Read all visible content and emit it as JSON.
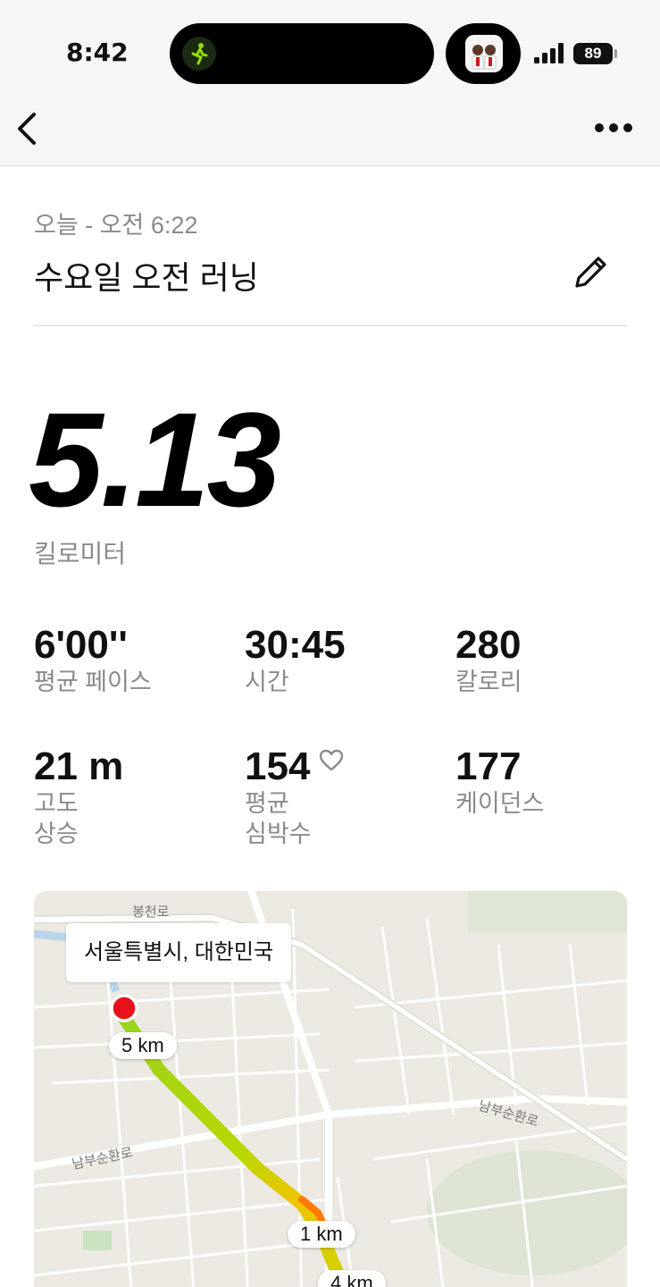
{
  "status_bar": {
    "time": "8:42",
    "battery": "89"
  },
  "activity": {
    "date": "오늘 - 오전 6:22",
    "title": "수요일 오전 러닝",
    "distance": "5.13",
    "distance_unit": "킬로미터"
  },
  "stats": [
    {
      "value": "6'00''",
      "label": "평균 페이스"
    },
    {
      "value": "30:45",
      "label": "시간"
    },
    {
      "value": "280",
      "label": "칼로리"
    },
    {
      "value": "21 m",
      "label": "고도\n상승"
    },
    {
      "value": "154",
      "label": "평균\n심박수"
    },
    {
      "value": "177",
      "label": "케이던스"
    }
  ],
  "map": {
    "location": "서울특별시, 대한민국",
    "roads": [
      "봉천로",
      "남부순환로",
      "남부순환로"
    ],
    "markers": [
      "5 km",
      "1 km",
      "4 km"
    ]
  },
  "colors": {
    "route_start": "#9bd21e",
    "route_mid": "#f0c400",
    "route_hot": "#ff7a00",
    "start_dot": "#e8101a"
  },
  "icons": [
    "walking-icon",
    "back-chevron-icon",
    "more-dots-icon",
    "edit-pencil-icon",
    "heart-icon"
  ]
}
